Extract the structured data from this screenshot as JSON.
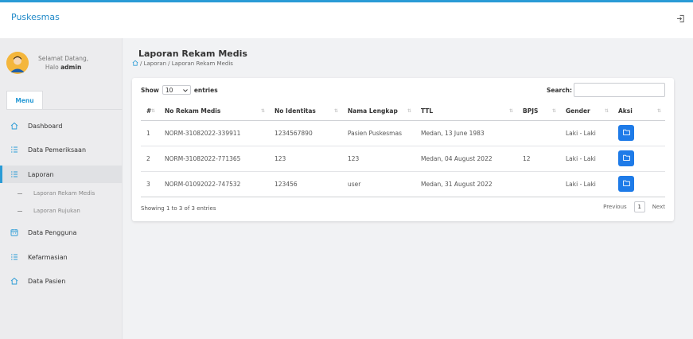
{
  "app": {
    "brand": "Puskesmas"
  },
  "user": {
    "greeting": "Selamat Datang,",
    "hello": "Halo",
    "name": "admin"
  },
  "sidebar": {
    "menu_tab": "Menu",
    "items": [
      {
        "label": "Dashboard",
        "icon": "home-icon"
      },
      {
        "label": "Data Pemeriksaan",
        "icon": "list-icon"
      },
      {
        "label": "Laporan",
        "icon": "list-icon",
        "active": true
      },
      {
        "label": "Data Pengguna",
        "icon": "calendar-icon"
      },
      {
        "label": "Kefarmasian",
        "icon": "list-icon"
      },
      {
        "label": "Data Pasien",
        "icon": "home-icon"
      }
    ],
    "sub_items": [
      {
        "label": "Laporan Rekam Medis"
      },
      {
        "label": "Laporan Rujukan"
      }
    ]
  },
  "page": {
    "title": "Laporan Rekam Medis",
    "breadcrumb": [
      " / Laporan",
      " / Laporan Rekam Medis"
    ]
  },
  "table_controls": {
    "show_label": "Show",
    "entries_value": "10",
    "entries_label": "entries",
    "search_label": "Search:",
    "search_value": ""
  },
  "table": {
    "columns": [
      "#",
      "No Rekam Medis",
      "No Identitas",
      "Nama Lengkap",
      "TTL",
      "BPJS",
      "Gender",
      "Aksi"
    ],
    "rows": [
      {
        "no": "1",
        "rekam": "NORM-31082022-339911",
        "identitas": "1234567890",
        "nama": "Pasien Puskesmas",
        "ttl": "Medan, 13 June 1983",
        "bpjs": "",
        "gender": "Laki - Laki"
      },
      {
        "no": "2",
        "rekam": "NORM-31082022-771365",
        "identitas": "123",
        "nama": "123",
        "ttl": "Medan, 04 August 2022",
        "bpjs": "12",
        "gender": "Laki - Laki"
      },
      {
        "no": "3",
        "rekam": "NORM-01092022-747532",
        "identitas": "123456",
        "nama": "user",
        "ttl": "Medan, 31 August 2022",
        "bpjs": "",
        "gender": "Laki - Laki"
      }
    ]
  },
  "footer": {
    "info": "Showing 1 to 3 of 3 entries",
    "previous": "Previous",
    "page": "1",
    "next": "Next"
  },
  "colors": {
    "accent": "#2a9bd6",
    "action_button": "#1e7be8"
  }
}
